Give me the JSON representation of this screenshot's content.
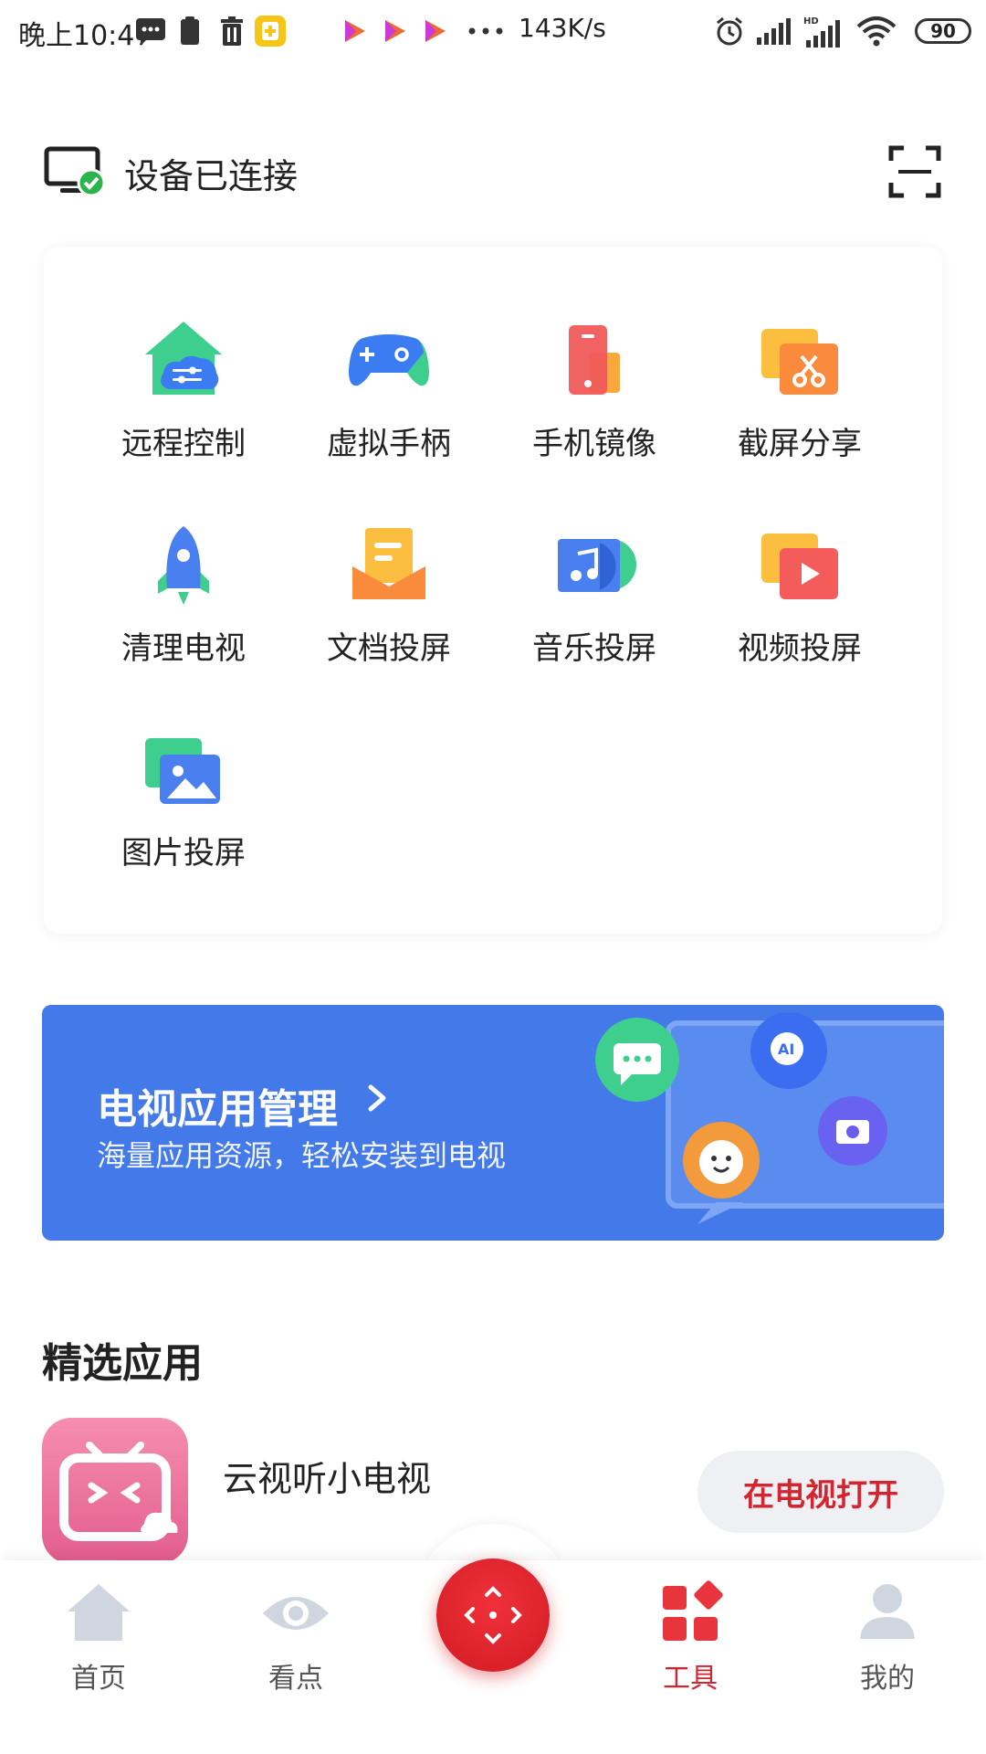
{
  "status_bar": {
    "time": "晚上10:47",
    "net_speed": "143K/s",
    "battery": "90"
  },
  "header": {
    "device_status": "设备已连接"
  },
  "tools": [
    {
      "label": "远程控制",
      "icon": "remote-control-icon"
    },
    {
      "label": "虚拟手柄",
      "icon": "gamepad-icon"
    },
    {
      "label": "手机镜像",
      "icon": "phone-mirror-icon"
    },
    {
      "label": "截屏分享",
      "icon": "screenshot-share-icon"
    },
    {
      "label": "清理电视",
      "icon": "rocket-icon"
    },
    {
      "label": "文档投屏",
      "icon": "document-cast-icon"
    },
    {
      "label": "音乐投屏",
      "icon": "music-cast-icon"
    },
    {
      "label": "视频投屏",
      "icon": "video-cast-icon"
    },
    {
      "label": "图片投屏",
      "icon": "image-cast-icon"
    }
  ],
  "banner": {
    "title": "电视应用管理",
    "subtitle": "海量应用资源，轻松安装到电视",
    "background": "#4379e8"
  },
  "featured": {
    "title": "精选应用",
    "apps": [
      {
        "name": "云视听小电视",
        "action": "在电视打开"
      }
    ]
  },
  "bottom_nav": {
    "items": [
      {
        "label": "首页",
        "icon": "home-icon"
      },
      {
        "label": "看点",
        "icon": "eye-icon"
      },
      {
        "label": "工具",
        "icon": "tools-icon",
        "active": true
      },
      {
        "label": "我的",
        "icon": "profile-icon"
      }
    ],
    "active_color": "#d3252f"
  }
}
